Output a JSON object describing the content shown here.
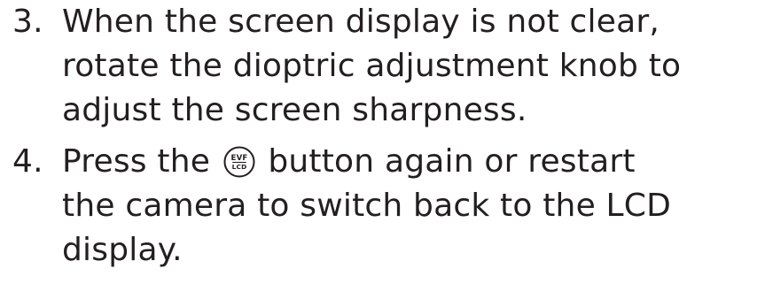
{
  "steps": [
    {
      "number": "3.",
      "lines": [
        "When the screen display is not clear,",
        "rotate the dioptric adjustment knob to",
        "adjust the screen sharpness."
      ]
    },
    {
      "number": "4.",
      "line1_before_icon": "Press the ",
      "icon": {
        "name": "evf-lcd-button-icon",
        "top_text": "EVF",
        "bottom_text": "LCD"
      },
      "line1_after_icon": " button again or restart",
      "lines_rest": [
        "the camera to switch back to the LCD",
        "display."
      ]
    }
  ]
}
